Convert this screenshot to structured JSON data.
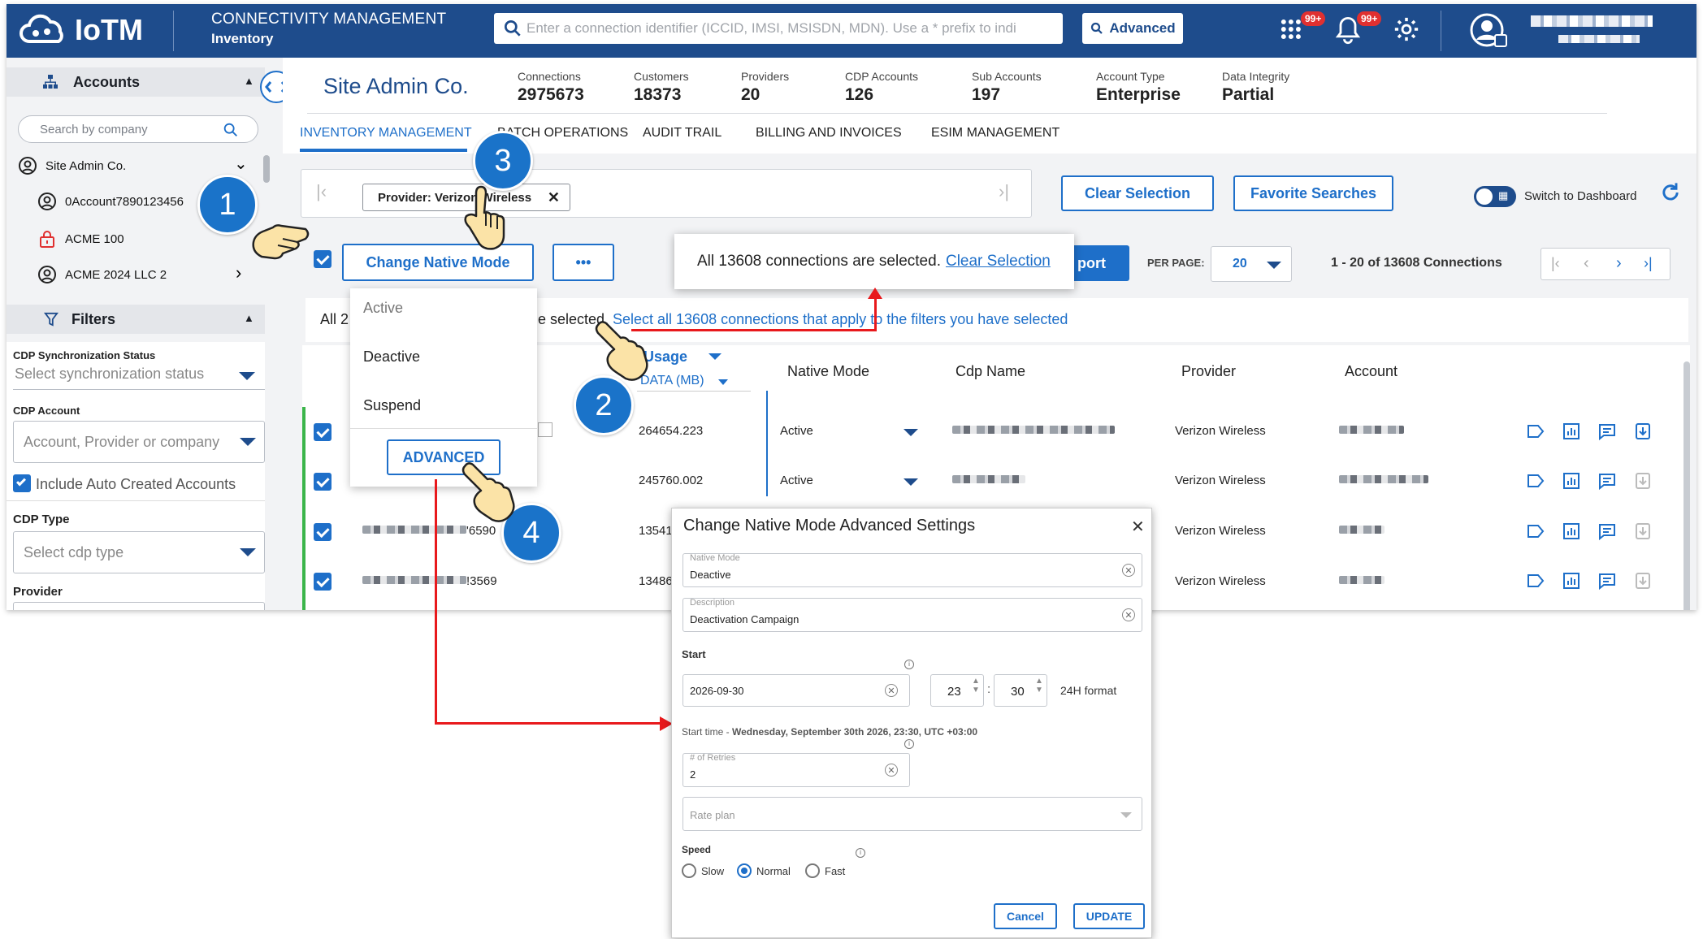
{
  "header": {
    "brand": "IoTM",
    "title": "CONNECTIVITY MANAGEMENT",
    "subtitle": "Inventory",
    "search_placeholder": "Enter a connection identifier (ICCID, IMSI, MSISDN, MDN). Use a * prefix to indi",
    "advanced_label": "Advanced",
    "apps_badge": "99+",
    "bell_badge": "99+"
  },
  "sidebar": {
    "accounts_title": "Accounts",
    "search_placeholder": "Search by company",
    "items": [
      {
        "label": "Site Admin Co.",
        "icon": "user-circle-icon"
      },
      {
        "label": "0Account7890123456",
        "icon": "user-circle-icon"
      },
      {
        "label": "ACME 100",
        "icon": "lock-icon"
      },
      {
        "label": "ACME 2024 LLC 2",
        "icon": "user-circle-icon"
      }
    ],
    "filters_title": "Filters",
    "filters": {
      "sync_label": "CDP Synchronization Status",
      "sync_placeholder": "Select synchronization status",
      "account_label": "CDP Account",
      "account_placeholder": "Account, Provider or company",
      "include_auto": "Include Auto Created Accounts",
      "cdp_type_label": "CDP Type",
      "cdp_type_placeholder": "Select cdp type",
      "provider_label": "Provider"
    }
  },
  "company": {
    "name": "Site Admin Co.",
    "kpis": [
      {
        "label": "Connections",
        "value": "2975673"
      },
      {
        "label": "Customers",
        "value": "18373"
      },
      {
        "label": "Providers",
        "value": "20"
      },
      {
        "label": "CDP Accounts",
        "value": "126"
      },
      {
        "label": "Sub Accounts",
        "value": "197"
      },
      {
        "label": "Account Type",
        "value": "Enterprise"
      },
      {
        "label": "Data Integrity",
        "value": "Partial"
      }
    ]
  },
  "tabs": [
    "INVENTORY MANAGEMENT",
    "BATCH OPERATIONS",
    "AUDIT TRAIL",
    "BILLING AND INVOICES",
    "ESIM MANAGEMENT"
  ],
  "toolbar": {
    "chip": "Provider: Verizon Wireless",
    "clear_selection": "Clear Selection",
    "favorite_searches": "Favorite Searches",
    "switch_dashboard": "Switch to Dashboard",
    "change_native_mode": "Change Native Mode",
    "more": "•••",
    "export": "port",
    "per_page_label": "PER PAGE:",
    "per_page": "20",
    "range": "1 - 20 of 13608 Connections"
  },
  "selection": {
    "prefix": "All 2",
    "middle": "e selected.",
    "link": "Select all 13608 connections that apply to the filters you have selected",
    "notice_text": "All 13608 connections are selected.",
    "notice_link": "Clear Selection"
  },
  "menu": {
    "items": [
      "Active",
      "Deactive",
      "Suspend"
    ],
    "advanced": "ADVANCED"
  },
  "table": {
    "usage_label": "Usage",
    "data_label": "DATA (MB)",
    "columns": [
      "Native Mode",
      "Cdp Name",
      "Provider",
      "Account"
    ],
    "rows": [
      {
        "id_suffix": "",
        "usage": "264654.223",
        "mode": "Active",
        "provider": "Verizon Wireless"
      },
      {
        "id_suffix": "",
        "usage": "245760.002",
        "mode": "Active",
        "provider": "Verizon Wireless"
      },
      {
        "id_suffix": "'6590",
        "usage": "13541",
        "mode": "",
        "provider": "Verizon Wireless"
      },
      {
        "id_suffix": "!3569",
        "usage": "13486",
        "mode": "",
        "provider": "Verizon Wireless"
      }
    ]
  },
  "dialog": {
    "title": "Change Native Mode Advanced Settings",
    "native_mode_label": "Native Mode",
    "native_mode_value": "Deactive",
    "description_label": "Description",
    "description_value": "Deactivation Campaign",
    "start_label": "Start",
    "date_value": "2026-09-30",
    "hour": "23",
    "minute": "30",
    "format": "24H format",
    "start_time_prefix": "Start time - ",
    "start_time_value": "Wednesday, September 30th 2026, 23:30, UTC +03:00",
    "retries_label": "# of Retries",
    "retries_value": "2",
    "rate_plan_placeholder": "Rate plan",
    "speed_label": "Speed",
    "speeds": [
      "Slow",
      "Normal",
      "Fast"
    ],
    "speed_selected": "Normal",
    "cancel": "Cancel",
    "update": "UPDATE"
  },
  "callouts": [
    "1",
    "2",
    "3",
    "4"
  ],
  "colors": {
    "brand": "#1e4c8c",
    "accent": "#1e6fc9",
    "callout": "#1a73c9",
    "arrow": "#e8191c",
    "badge": "#e03030"
  }
}
